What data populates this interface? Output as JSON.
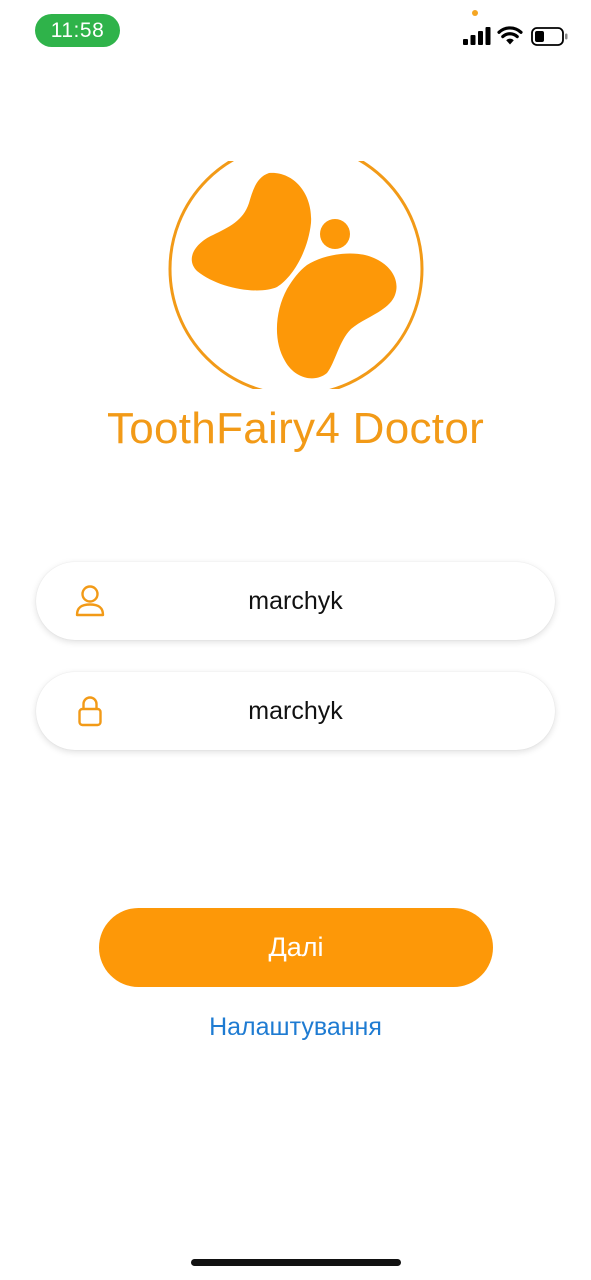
{
  "status_bar": {
    "time": "11:58",
    "time_pill_color": "#2fb34a",
    "icons": [
      "signal-icon",
      "wifi-icon",
      "battery-icon"
    ]
  },
  "brand": {
    "app_title": "ToothFairy4 Doctor",
    "accent_color": "#f29a17"
  },
  "login_form": {
    "username": {
      "value": "marchyk",
      "icon": "user-icon"
    },
    "password": {
      "value": "marchyk",
      "icon": "lock-icon"
    }
  },
  "actions": {
    "next_label": "Далі",
    "next_color": "#fd9808",
    "settings_label": "Налаштування",
    "settings_color": "#1e7bd2"
  }
}
